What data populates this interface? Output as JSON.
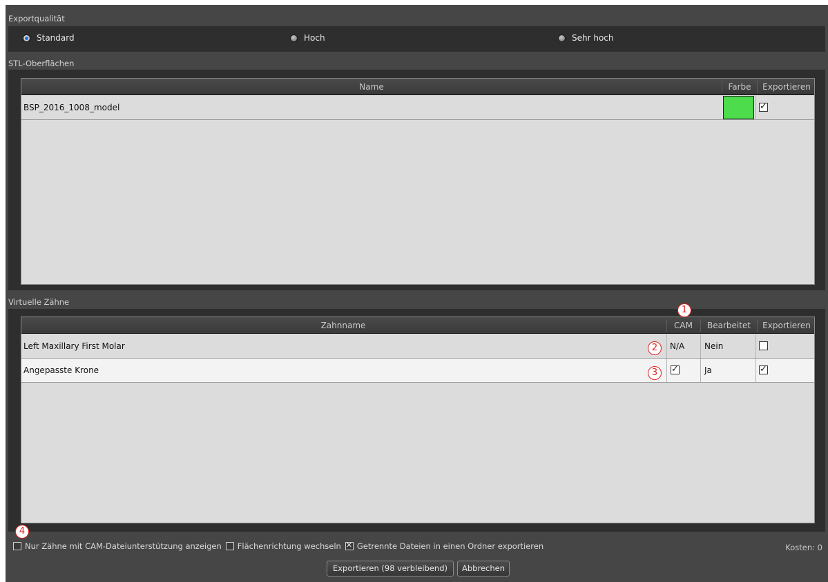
{
  "export_quality": {
    "label": "Exportqualität",
    "options": [
      {
        "label": "Standard",
        "selected": true
      },
      {
        "label": "Hoch",
        "selected": false
      },
      {
        "label": "Sehr hoch",
        "selected": false
      }
    ]
  },
  "stl_surfaces": {
    "label": "STL-Oberflächen",
    "columns": {
      "name": "Name",
      "color": "Farbe",
      "export": "Exportieren"
    },
    "rows": [
      {
        "name": "BSP_2016_1008_model",
        "color": "#4cdc4c",
        "export": true
      }
    ]
  },
  "virtual_teeth": {
    "label": "Virtuelle Zähne",
    "columns": {
      "name": "Zahnname",
      "cam": "CAM",
      "edited": "Bearbeitet",
      "export": "Exportieren"
    },
    "rows": [
      {
        "name": "Left Maxillary First Molar",
        "cam": "N/A",
        "cam_checkbox": false,
        "edited": "Nein",
        "export": false
      },
      {
        "name": "Angepasste Krone",
        "cam": "",
        "cam_checkbox": true,
        "edited": "Ja",
        "export": true
      }
    ]
  },
  "callouts": [
    "1",
    "2",
    "3",
    "4"
  ],
  "bottom_options": {
    "cam_only": {
      "label": "Nur Zähne mit CAM-Dateiunterstützung anzeigen",
      "checked": false
    },
    "flip_normals": {
      "label": "Flächenrichtung wechseln",
      "checked": false
    },
    "separate_files": {
      "label": "Getrennte Dateien in einen Ordner exportieren",
      "checked": true
    }
  },
  "cost": "Kosten: 0",
  "buttons": {
    "export": "Exportieren (98 verbleibend)",
    "cancel": "Abbrechen"
  },
  "colors": {
    "accent": "#1e6fd6",
    "callout": "#e02020",
    "swatch_green": "#4cdc4c"
  }
}
